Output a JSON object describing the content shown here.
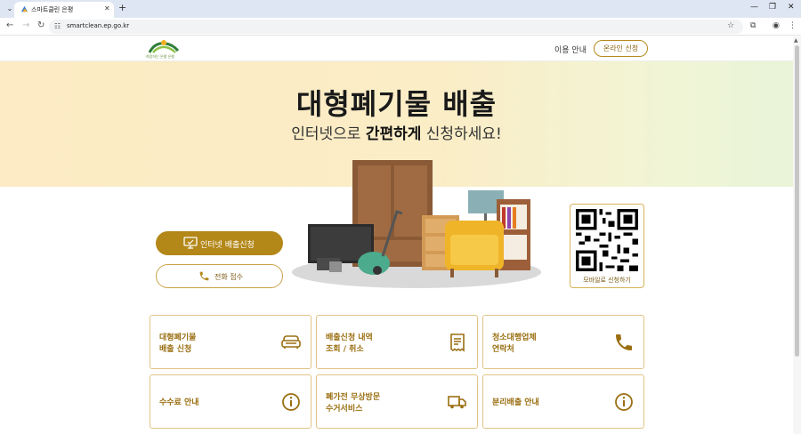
{
  "browser": {
    "tab_title": "스마트클린 은평",
    "url": "smartclean.ep.go.kr"
  },
  "header": {
    "logo_text": "희망하는 은평 은평",
    "nav_guide": "이용 안내",
    "nav_apply": "온라인 신청"
  },
  "hero": {
    "title": "대형폐기물 배출",
    "subtitle_pre": "인터넷으로 ",
    "subtitle_bold": "간편하게",
    "subtitle_post": " 신청하세요!"
  },
  "actions": {
    "internet_label": "인터넷 배출신청",
    "phone_label": "전화 접수",
    "qr_label": "모바일로 신청하기"
  },
  "cards": [
    {
      "line1": "대형폐기물",
      "line2": "배출 신청",
      "icon": "sofa-icon"
    },
    {
      "line1": "배출신청 내역",
      "line2": "조회 / 취소",
      "icon": "receipt-icon"
    },
    {
      "line1": "청소대행업체",
      "line2": "연락처",
      "icon": "phone-icon"
    },
    {
      "line1": "수수료 안내",
      "line2": "",
      "icon": "info-icon"
    },
    {
      "line1": "폐가전 무상방문",
      "line2": "수거서비스",
      "icon": "truck-icon"
    },
    {
      "line1": "분리배출 안내",
      "line2": "",
      "icon": "info-icon"
    }
  ],
  "colors": {
    "accent": "#b38718",
    "card_text": "#9a6f12",
    "hero_bg": "#fcebc4"
  }
}
